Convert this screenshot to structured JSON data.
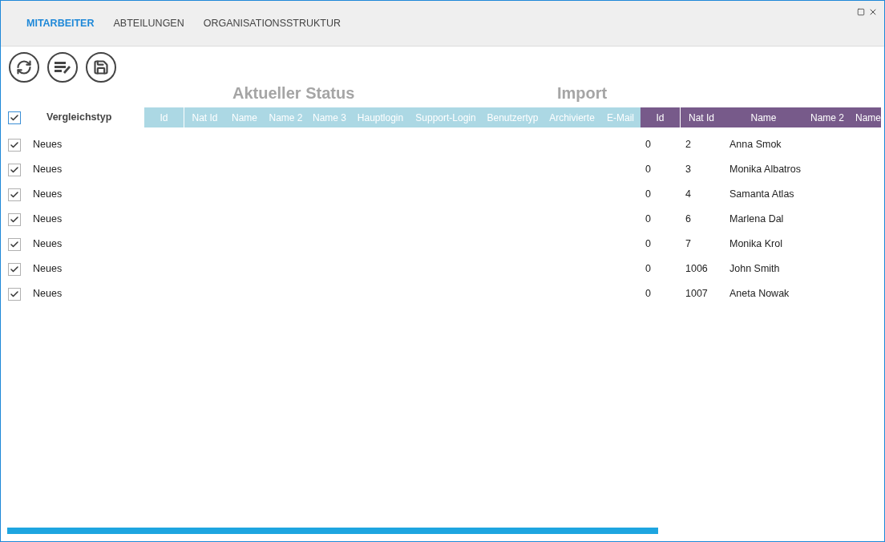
{
  "tabs": [
    {
      "label": "MITARBEITER",
      "selected": true
    },
    {
      "label": "ABTEILUNGEN",
      "selected": false
    },
    {
      "label": "ORGANISATIONSSTRUKTUR",
      "selected": false
    }
  ],
  "groups": [
    "Aktueller Status",
    "Import"
  ],
  "header": {
    "checked": true,
    "label": "Vergleichstyp"
  },
  "current_columns": [
    "Id",
    "Nat Id",
    "Name",
    "Name 2",
    "Name 3",
    "Hauptlogin",
    "Support-Login",
    "Benutzertyp",
    "Archivierte",
    "E-Mail"
  ],
  "import_columns": [
    "Id",
    "Nat Id",
    "Name",
    "Name 2",
    "Name"
  ],
  "rows": [
    {
      "checked": true,
      "type": "Neues",
      "import": [
        "0",
        "2",
        "Anna Smok"
      ]
    },
    {
      "checked": true,
      "type": "Neues",
      "import": [
        "0",
        "3",
        "Monika Albatros"
      ]
    },
    {
      "checked": true,
      "type": "Neues",
      "import": [
        "0",
        "4",
        "Samanta Atlas"
      ]
    },
    {
      "checked": true,
      "type": "Neues",
      "import": [
        "0",
        "6",
        "Marlena Dal"
      ]
    },
    {
      "checked": true,
      "type": "Neues",
      "import": [
        "0",
        "7",
        "Monika Krol"
      ]
    },
    {
      "checked": true,
      "type": "Neues",
      "import": [
        "0",
        "1006",
        "John Smith"
      ]
    },
    {
      "checked": true,
      "type": "Neues",
      "import": [
        "0",
        "1007",
        "Aneta Nowak"
      ]
    }
  ]
}
